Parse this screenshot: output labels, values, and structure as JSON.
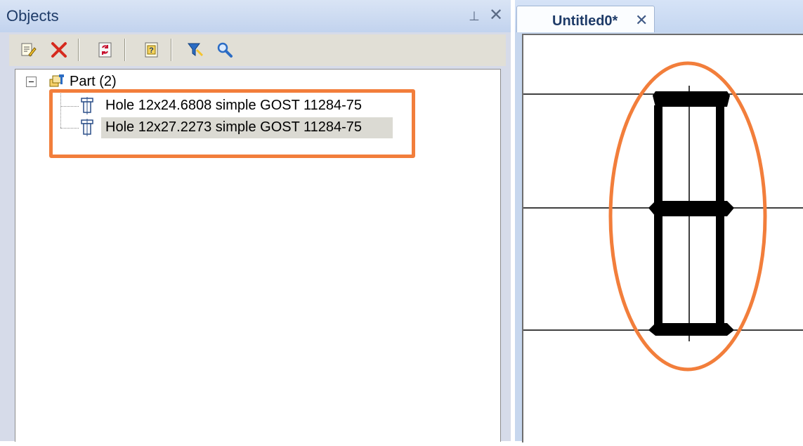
{
  "objects_panel": {
    "title": "Objects",
    "pin_icon": "pin-icon",
    "close_icon": "close-icon",
    "toolbar": [
      {
        "name": "edit-properties-button",
        "icon": "edit-icon"
      },
      {
        "name": "delete-button",
        "icon": "delete-x-icon"
      },
      {
        "name": "rebuild-button",
        "icon": "refresh-icon"
      },
      {
        "name": "help-button",
        "icon": "question-icon"
      },
      {
        "name": "filter-button",
        "icon": "filter-icon"
      },
      {
        "name": "search-button",
        "icon": "magnifier-icon"
      }
    ],
    "tree": {
      "root": {
        "label": "Part (2)",
        "icon": "part-icon",
        "expanded": true
      },
      "children": [
        {
          "label": "Hole 12x24.6808 simple GOST 11284-75",
          "icon": "hole-icon",
          "selected": false
        },
        {
          "label": "Hole 12x27.2273 simple GOST 11284-75",
          "icon": "hole-icon",
          "selected": true
        }
      ]
    },
    "highlight_color": "#f27e3b"
  },
  "document": {
    "tab_label": "Untitled0*",
    "tab_close_icon": "close-icon"
  },
  "colors": {
    "panel_title": "#1e3b68",
    "annotation": "#f27e3b",
    "toolbar_bg": "#e1dfd6",
    "selection_bg": "#dbdad3"
  }
}
